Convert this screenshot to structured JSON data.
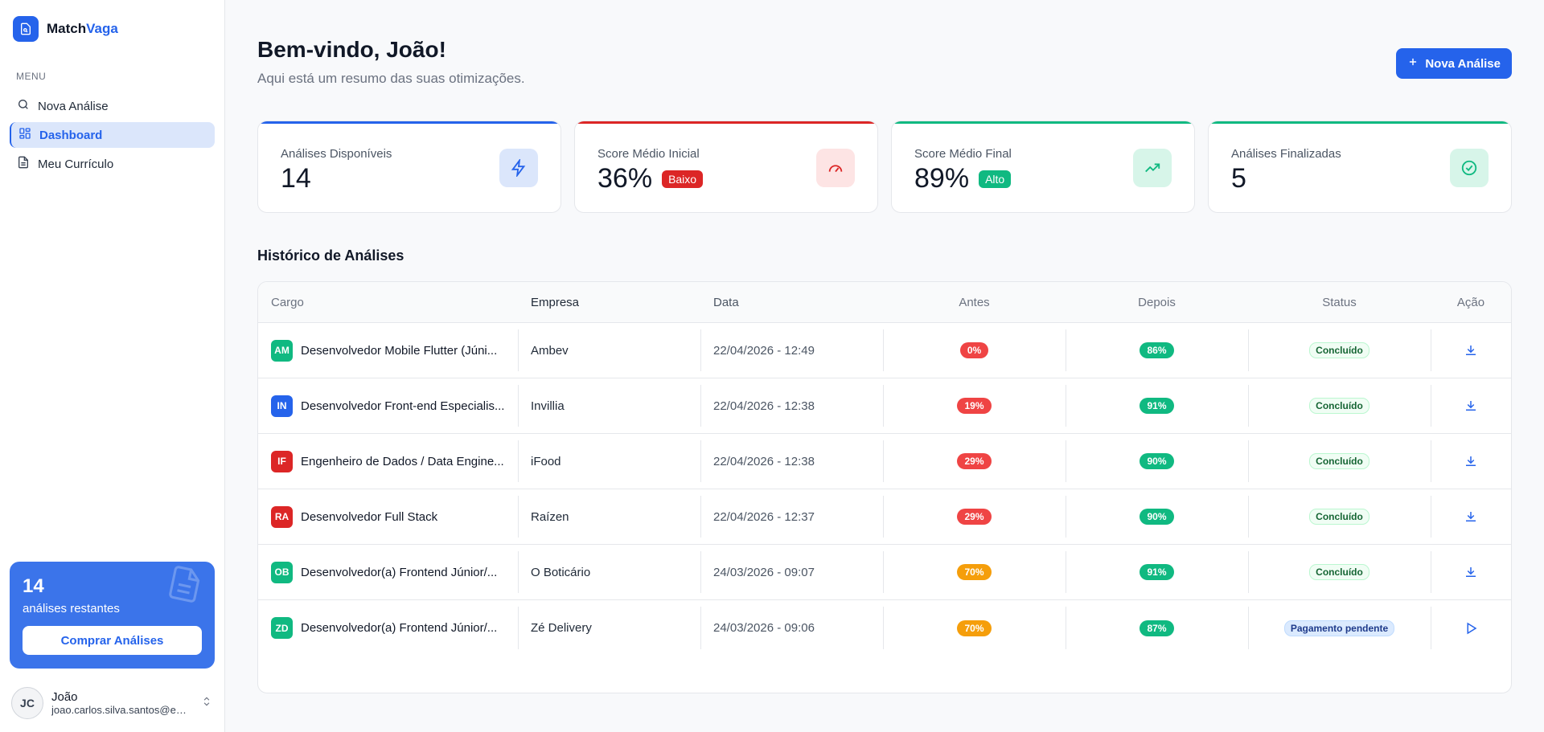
{
  "app": {
    "brand_part1": "Match",
    "brand_part2": "Vaga",
    "brand_color": "#2563eb"
  },
  "sidebar": {
    "menu_label": "MENU",
    "items": [
      {
        "label": "Nova Análise",
        "icon": "search-icon",
        "active": false
      },
      {
        "label": "Dashboard",
        "icon": "dashboard-icon",
        "active": true
      },
      {
        "label": "Meu Currículo",
        "icon": "document-icon",
        "active": false
      }
    ],
    "promo": {
      "count": "14",
      "subtitle": "análises restantes",
      "button": "Comprar Análises"
    },
    "user": {
      "initials": "JC",
      "name": "João",
      "email": "joao.carlos.silva.santos@em..."
    }
  },
  "header": {
    "title": "Bem-vindo, João!",
    "subtitle": "Aqui está um resumo das suas otimizações.",
    "new_button": "Nova Análise"
  },
  "stats": [
    {
      "label": "Análises Disponíveis",
      "value": "14",
      "badge": "",
      "accent": "#2563eb",
      "icon": "lightning-icon"
    },
    {
      "label": "Score Médio Inicial",
      "value": "36%",
      "badge": "Baixo",
      "badge_color": "#dc2626",
      "accent": "#dc2626",
      "icon": "gauge-icon"
    },
    {
      "label": "Score Médio Final",
      "value": "89%",
      "badge": "Alto",
      "badge_color": "#10b981",
      "accent": "#10b981",
      "icon": "trending-up-icon"
    },
    {
      "label": "Análises Finalizadas",
      "value": "5",
      "badge": "",
      "accent": "#10b981",
      "icon": "check-circle-icon"
    }
  ],
  "history": {
    "title": "Histórico de Análises",
    "columns": [
      "Cargo",
      "Empresa",
      "Data",
      "Antes",
      "Depois",
      "Status",
      "Ação"
    ],
    "rows": [
      {
        "initials": "AM",
        "initials_color": "#10b981",
        "cargo": "Desenvolvedor Mobile Flutter (Júni...",
        "empresa": "Ambev",
        "data": "22/04/2026 - 12:49",
        "antes": "0%",
        "antes_color": "#ef4444",
        "depois": "86%",
        "status": "Concluído",
        "action": "download-icon"
      },
      {
        "initials": "IN",
        "initials_color": "#2563eb",
        "cargo": "Desenvolvedor Front-end Especialis...",
        "empresa": "Invillia",
        "data": "22/04/2026 - 12:38",
        "antes": "19%",
        "antes_color": "#ef4444",
        "depois": "91%",
        "status": "Concluído",
        "action": "download-icon"
      },
      {
        "initials": "IF",
        "initials_color": "#dc2626",
        "cargo": "Engenheiro de Dados / Data Engine...",
        "empresa": "iFood",
        "data": "22/04/2026 - 12:38",
        "antes": "29%",
        "antes_color": "#ef4444",
        "depois": "90%",
        "status": "Concluído",
        "action": "download-icon"
      },
      {
        "initials": "RA",
        "initials_color": "#dc2626",
        "cargo": "Desenvolvedor Full Stack",
        "empresa": "Raízen",
        "data": "22/04/2026 - 12:37",
        "antes": "29%",
        "antes_color": "#ef4444",
        "depois": "90%",
        "status": "Concluído",
        "action": "download-icon"
      },
      {
        "initials": "OB",
        "initials_color": "#10b981",
        "cargo": "Desenvolvedor(a) Frontend Júnior/...",
        "empresa": "O Boticário",
        "data": "24/03/2026 - 09:07",
        "antes": "70%",
        "antes_color": "#f59e0b",
        "depois": "91%",
        "status": "Concluído",
        "action": "download-icon"
      },
      {
        "initials": "ZD",
        "initials_color": "#10b981",
        "cargo": "Desenvolvedor(a) Frontend Júnior/...",
        "empresa": "Zé Delivery",
        "data": "24/03/2026 - 09:06",
        "antes": "70%",
        "antes_color": "#f59e0b",
        "depois": "87%",
        "status": "Pagamento pendente",
        "action": "play-icon"
      }
    ]
  }
}
